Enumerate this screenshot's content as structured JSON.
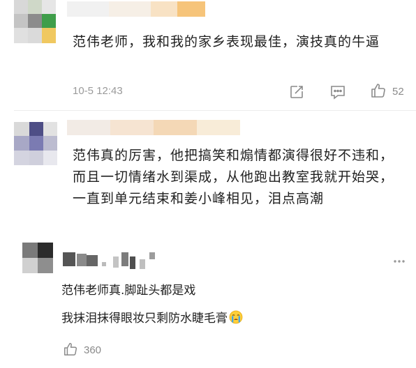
{
  "comments": [
    {
      "text": "范伟老师，我和我的家乡表现最佳，演技真的牛逼",
      "time": "10-5 12:43",
      "likes": "52",
      "icons": [
        "forward-icon",
        "reply-icon",
        "thumbs-up-icon"
      ]
    },
    {
      "text": "范伟真的厉害，他把搞笑和煽情都演得很好不违和，而且一切情绪水到渠成，从他跑出教室我就开始哭，一直到单元结束和姜小峰相见，泪点高潮"
    }
  ],
  "reply": {
    "line1": "范伟老师真.脚趾头都是戏",
    "line2": "我抹泪抹得眼妆只剩防水睫毛膏",
    "emoji": "crying-face-icon",
    "likes": "360",
    "more_icon": "more-dots-icon"
  },
  "colors": {
    "background": "#ffffff",
    "text": "#1f1f1f",
    "meta": "#9a9a9a",
    "divider": "#ececec"
  }
}
